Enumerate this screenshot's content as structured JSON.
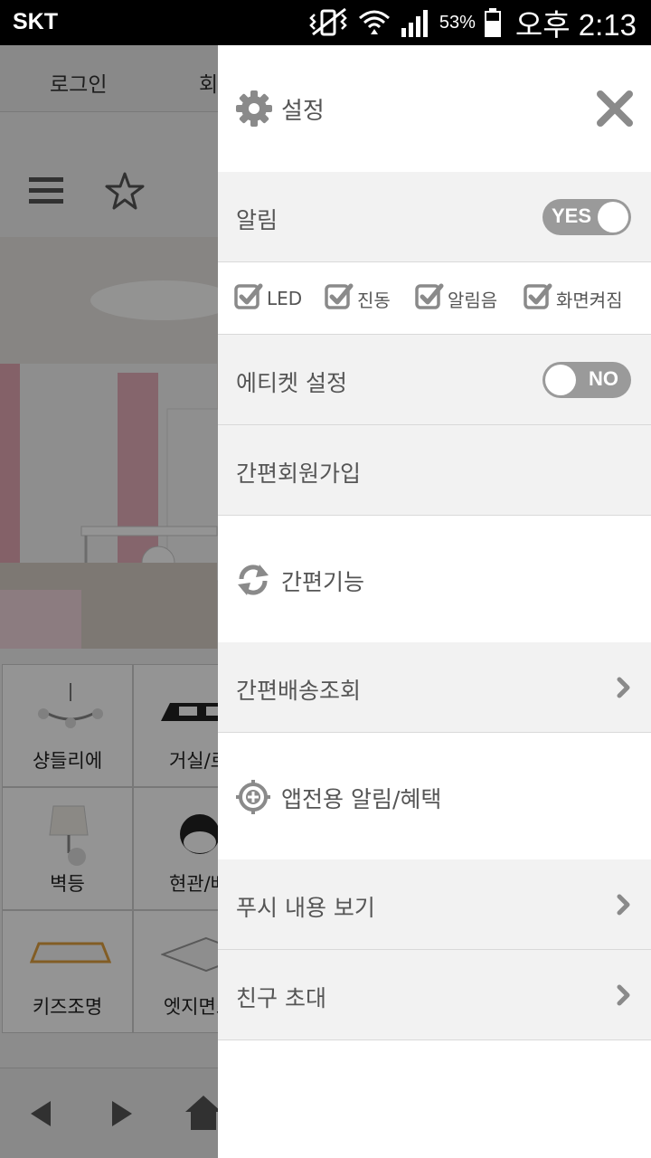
{
  "status_bar": {
    "carrier": "SKT",
    "battery_percent": "53%",
    "time": "오후 2:13"
  },
  "background": {
    "nav": [
      "로그인",
      "회"
    ],
    "grid": [
      "샹들리에",
      "거실/로",
      "벽등",
      "현관/베",
      "키즈조명",
      "엣지면조"
    ]
  },
  "drawer": {
    "title": "설정",
    "notification": {
      "label": "알림",
      "toggle": "YES"
    },
    "options": [
      "LED",
      "진동",
      "알림음",
      "화면켜짐"
    ],
    "etiquette": {
      "label": "에티켓 설정",
      "toggle": "NO"
    },
    "easy_signup": "간편회원가입",
    "easy_features": "간편기능",
    "delivery_lookup": "간편배송조회",
    "app_benefits": "앱전용 알림/혜택",
    "push_view": "푸시 내용 보기",
    "invite_friends": "친구 초대"
  },
  "colors": {
    "toggle": "#9a9a9a",
    "section_gray": "#f2f2f2",
    "text": "#555555",
    "icon": "#8a8a8a"
  }
}
